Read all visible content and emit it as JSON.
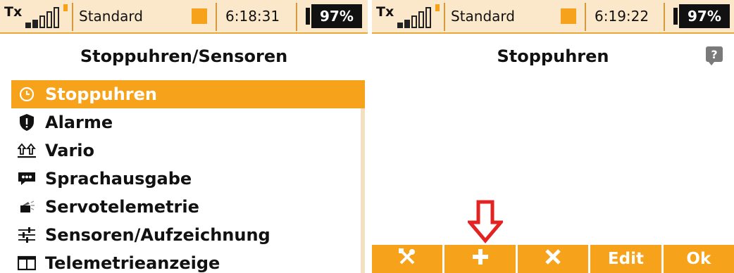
{
  "colors": {
    "accent": "#f7a21b",
    "statusbar_bg": "#fbe7c9",
    "arrow": "#e32222"
  },
  "left": {
    "status": {
      "tx_label": "Tx",
      "model": "Standard",
      "time": "6:18:31",
      "battery": "97%"
    },
    "title": "Stoppuhren/Sensoren",
    "menu": [
      {
        "label": "Stoppuhren",
        "icon": "clock-icon",
        "selected": true
      },
      {
        "label": "Alarme",
        "icon": "shield-alert-icon",
        "selected": false
      },
      {
        "label": "Vario",
        "icon": "vario-arrows-icon",
        "selected": false
      },
      {
        "label": "Sprachausgabe",
        "icon": "speech-bubble-icon",
        "selected": false
      },
      {
        "label": "Servotelemetrie",
        "icon": "servo-icon",
        "selected": false
      },
      {
        "label": "Sensoren/Aufzeichnung",
        "icon": "sliders-icon",
        "selected": false
      },
      {
        "label": "Telemetrieanzeige",
        "icon": "display-icon",
        "selected": false
      }
    ]
  },
  "right": {
    "status": {
      "tx_label": "Tx",
      "model": "Standard",
      "time": "6:19:22",
      "battery": "97%"
    },
    "title": "Stoppuhren",
    "help_label": "?",
    "toolbar": [
      {
        "label": "",
        "icon": "tools-icon"
      },
      {
        "label": "",
        "icon": "plus-icon"
      },
      {
        "label": "",
        "icon": "close-icon"
      },
      {
        "label": "Edit",
        "icon": ""
      },
      {
        "label": "Ok",
        "icon": ""
      }
    ]
  }
}
